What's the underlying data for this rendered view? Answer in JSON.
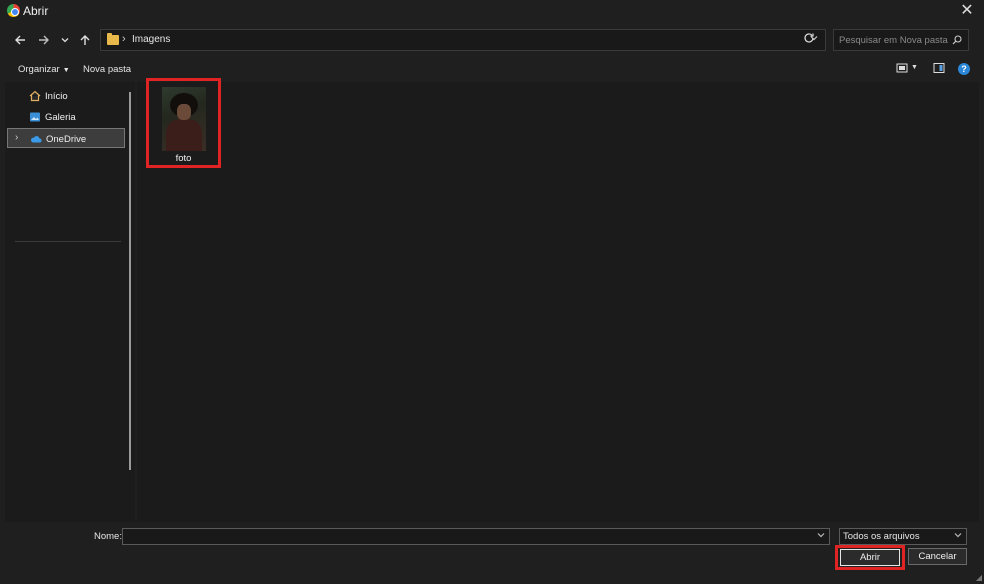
{
  "window": {
    "title": "Abrir"
  },
  "nav": {
    "breadcrumb": [
      "Imagens"
    ],
    "search_placeholder": "Pesquisar em Nova pasta"
  },
  "commands": {
    "organize": "Organizar",
    "new_folder": "Nova pasta"
  },
  "sidebar": {
    "items": [
      {
        "label": "Início",
        "icon": "home-icon"
      },
      {
        "label": "Galeria",
        "icon": "gallery-icon"
      },
      {
        "label": "OneDrive",
        "icon": "cloud-icon",
        "selected": true
      }
    ]
  },
  "files": [
    {
      "name": "foto",
      "type": "image",
      "highlighted": true
    }
  ],
  "footer": {
    "name_label": "Nome:",
    "name_value": "",
    "file_type": "Todos os arquivos",
    "open_label": "Abrir",
    "cancel_label": "Cancelar"
  },
  "colors": {
    "background": "#1f1f1f",
    "panel": "#1b1b1b",
    "highlight_border": "#e02424",
    "help_blue": "#2a86d6",
    "folder_yellow": "#e8b94a"
  }
}
